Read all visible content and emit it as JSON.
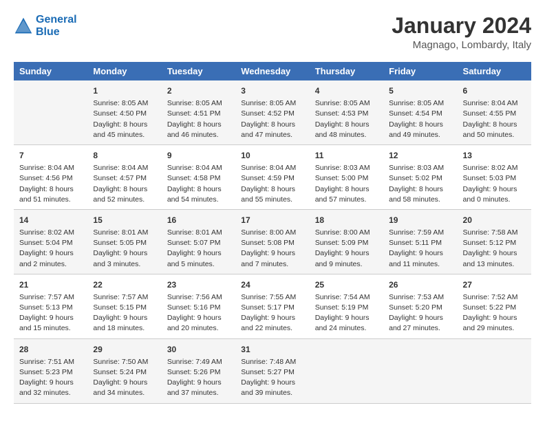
{
  "logo": {
    "line1": "General",
    "line2": "Blue"
  },
  "title": "January 2024",
  "location": "Magnago, Lombardy, Italy",
  "headers": [
    "Sunday",
    "Monday",
    "Tuesday",
    "Wednesday",
    "Thursday",
    "Friday",
    "Saturday"
  ],
  "weeks": [
    [
      {
        "day": "",
        "sunrise": "",
        "sunset": "",
        "daylight": ""
      },
      {
        "day": "1",
        "sunrise": "Sunrise: 8:05 AM",
        "sunset": "Sunset: 4:50 PM",
        "daylight": "Daylight: 8 hours and 45 minutes."
      },
      {
        "day": "2",
        "sunrise": "Sunrise: 8:05 AM",
        "sunset": "Sunset: 4:51 PM",
        "daylight": "Daylight: 8 hours and 46 minutes."
      },
      {
        "day": "3",
        "sunrise": "Sunrise: 8:05 AM",
        "sunset": "Sunset: 4:52 PM",
        "daylight": "Daylight: 8 hours and 47 minutes."
      },
      {
        "day": "4",
        "sunrise": "Sunrise: 8:05 AM",
        "sunset": "Sunset: 4:53 PM",
        "daylight": "Daylight: 8 hours and 48 minutes."
      },
      {
        "day": "5",
        "sunrise": "Sunrise: 8:05 AM",
        "sunset": "Sunset: 4:54 PM",
        "daylight": "Daylight: 8 hours and 49 minutes."
      },
      {
        "day": "6",
        "sunrise": "Sunrise: 8:04 AM",
        "sunset": "Sunset: 4:55 PM",
        "daylight": "Daylight: 8 hours and 50 minutes."
      }
    ],
    [
      {
        "day": "7",
        "sunrise": "Sunrise: 8:04 AM",
        "sunset": "Sunset: 4:56 PM",
        "daylight": "Daylight: 8 hours and 51 minutes."
      },
      {
        "day": "8",
        "sunrise": "Sunrise: 8:04 AM",
        "sunset": "Sunset: 4:57 PM",
        "daylight": "Daylight: 8 hours and 52 minutes."
      },
      {
        "day": "9",
        "sunrise": "Sunrise: 8:04 AM",
        "sunset": "Sunset: 4:58 PM",
        "daylight": "Daylight: 8 hours and 54 minutes."
      },
      {
        "day": "10",
        "sunrise": "Sunrise: 8:04 AM",
        "sunset": "Sunset: 4:59 PM",
        "daylight": "Daylight: 8 hours and 55 minutes."
      },
      {
        "day": "11",
        "sunrise": "Sunrise: 8:03 AM",
        "sunset": "Sunset: 5:00 PM",
        "daylight": "Daylight: 8 hours and 57 minutes."
      },
      {
        "day": "12",
        "sunrise": "Sunrise: 8:03 AM",
        "sunset": "Sunset: 5:02 PM",
        "daylight": "Daylight: 8 hours and 58 minutes."
      },
      {
        "day": "13",
        "sunrise": "Sunrise: 8:02 AM",
        "sunset": "Sunset: 5:03 PM",
        "daylight": "Daylight: 9 hours and 0 minutes."
      }
    ],
    [
      {
        "day": "14",
        "sunrise": "Sunrise: 8:02 AM",
        "sunset": "Sunset: 5:04 PM",
        "daylight": "Daylight: 9 hours and 2 minutes."
      },
      {
        "day": "15",
        "sunrise": "Sunrise: 8:01 AM",
        "sunset": "Sunset: 5:05 PM",
        "daylight": "Daylight: 9 hours and 3 minutes."
      },
      {
        "day": "16",
        "sunrise": "Sunrise: 8:01 AM",
        "sunset": "Sunset: 5:07 PM",
        "daylight": "Daylight: 9 hours and 5 minutes."
      },
      {
        "day": "17",
        "sunrise": "Sunrise: 8:00 AM",
        "sunset": "Sunset: 5:08 PM",
        "daylight": "Daylight: 9 hours and 7 minutes."
      },
      {
        "day": "18",
        "sunrise": "Sunrise: 8:00 AM",
        "sunset": "Sunset: 5:09 PM",
        "daylight": "Daylight: 9 hours and 9 minutes."
      },
      {
        "day": "19",
        "sunrise": "Sunrise: 7:59 AM",
        "sunset": "Sunset: 5:11 PM",
        "daylight": "Daylight: 9 hours and 11 minutes."
      },
      {
        "day": "20",
        "sunrise": "Sunrise: 7:58 AM",
        "sunset": "Sunset: 5:12 PM",
        "daylight": "Daylight: 9 hours and 13 minutes."
      }
    ],
    [
      {
        "day": "21",
        "sunrise": "Sunrise: 7:57 AM",
        "sunset": "Sunset: 5:13 PM",
        "daylight": "Daylight: 9 hours and 15 minutes."
      },
      {
        "day": "22",
        "sunrise": "Sunrise: 7:57 AM",
        "sunset": "Sunset: 5:15 PM",
        "daylight": "Daylight: 9 hours and 18 minutes."
      },
      {
        "day": "23",
        "sunrise": "Sunrise: 7:56 AM",
        "sunset": "Sunset: 5:16 PM",
        "daylight": "Daylight: 9 hours and 20 minutes."
      },
      {
        "day": "24",
        "sunrise": "Sunrise: 7:55 AM",
        "sunset": "Sunset: 5:17 PM",
        "daylight": "Daylight: 9 hours and 22 minutes."
      },
      {
        "day": "25",
        "sunrise": "Sunrise: 7:54 AM",
        "sunset": "Sunset: 5:19 PM",
        "daylight": "Daylight: 9 hours and 24 minutes."
      },
      {
        "day": "26",
        "sunrise": "Sunrise: 7:53 AM",
        "sunset": "Sunset: 5:20 PM",
        "daylight": "Daylight: 9 hours and 27 minutes."
      },
      {
        "day": "27",
        "sunrise": "Sunrise: 7:52 AM",
        "sunset": "Sunset: 5:22 PM",
        "daylight": "Daylight: 9 hours and 29 minutes."
      }
    ],
    [
      {
        "day": "28",
        "sunrise": "Sunrise: 7:51 AM",
        "sunset": "Sunset: 5:23 PM",
        "daylight": "Daylight: 9 hours and 32 minutes."
      },
      {
        "day": "29",
        "sunrise": "Sunrise: 7:50 AM",
        "sunset": "Sunset: 5:24 PM",
        "daylight": "Daylight: 9 hours and 34 minutes."
      },
      {
        "day": "30",
        "sunrise": "Sunrise: 7:49 AM",
        "sunset": "Sunset: 5:26 PM",
        "daylight": "Daylight: 9 hours and 37 minutes."
      },
      {
        "day": "31",
        "sunrise": "Sunrise: 7:48 AM",
        "sunset": "Sunset: 5:27 PM",
        "daylight": "Daylight: 9 hours and 39 minutes."
      },
      {
        "day": "",
        "sunrise": "",
        "sunset": "",
        "daylight": ""
      },
      {
        "day": "",
        "sunrise": "",
        "sunset": "",
        "daylight": ""
      },
      {
        "day": "",
        "sunrise": "",
        "sunset": "",
        "daylight": ""
      }
    ]
  ]
}
